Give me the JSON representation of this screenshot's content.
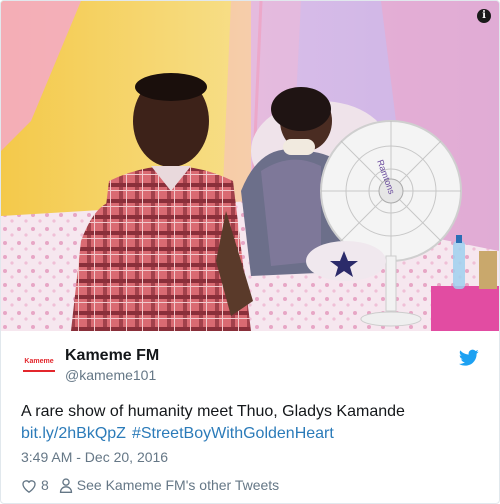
{
  "tweet": {
    "display_name": "Kameme FM",
    "screen_name": "@kameme101",
    "text": "A rare show of humanity meet Thuo, Gladys Kamande",
    "link": "bit.ly/2hBkQpZ",
    "hashtag": "#StreetBoyWithGoldenHeart",
    "timestamp": "3:49 AM - Dec 20, 2016",
    "like_count": "8",
    "other_tweets": "See Kameme FM's other Tweets"
  },
  "avatar_logo": "Kameme",
  "info_badge": "i",
  "fan_brand": "Ramtons",
  "icons": {
    "info": "info-icon",
    "twitter": "twitter-bird-icon",
    "heart": "heart-icon",
    "person": "person-icon"
  },
  "colors": {
    "link": "#2b7bb9",
    "muted": "#657786",
    "twitter_blue": "#1da1f2",
    "brand_red": "#e3262c"
  }
}
